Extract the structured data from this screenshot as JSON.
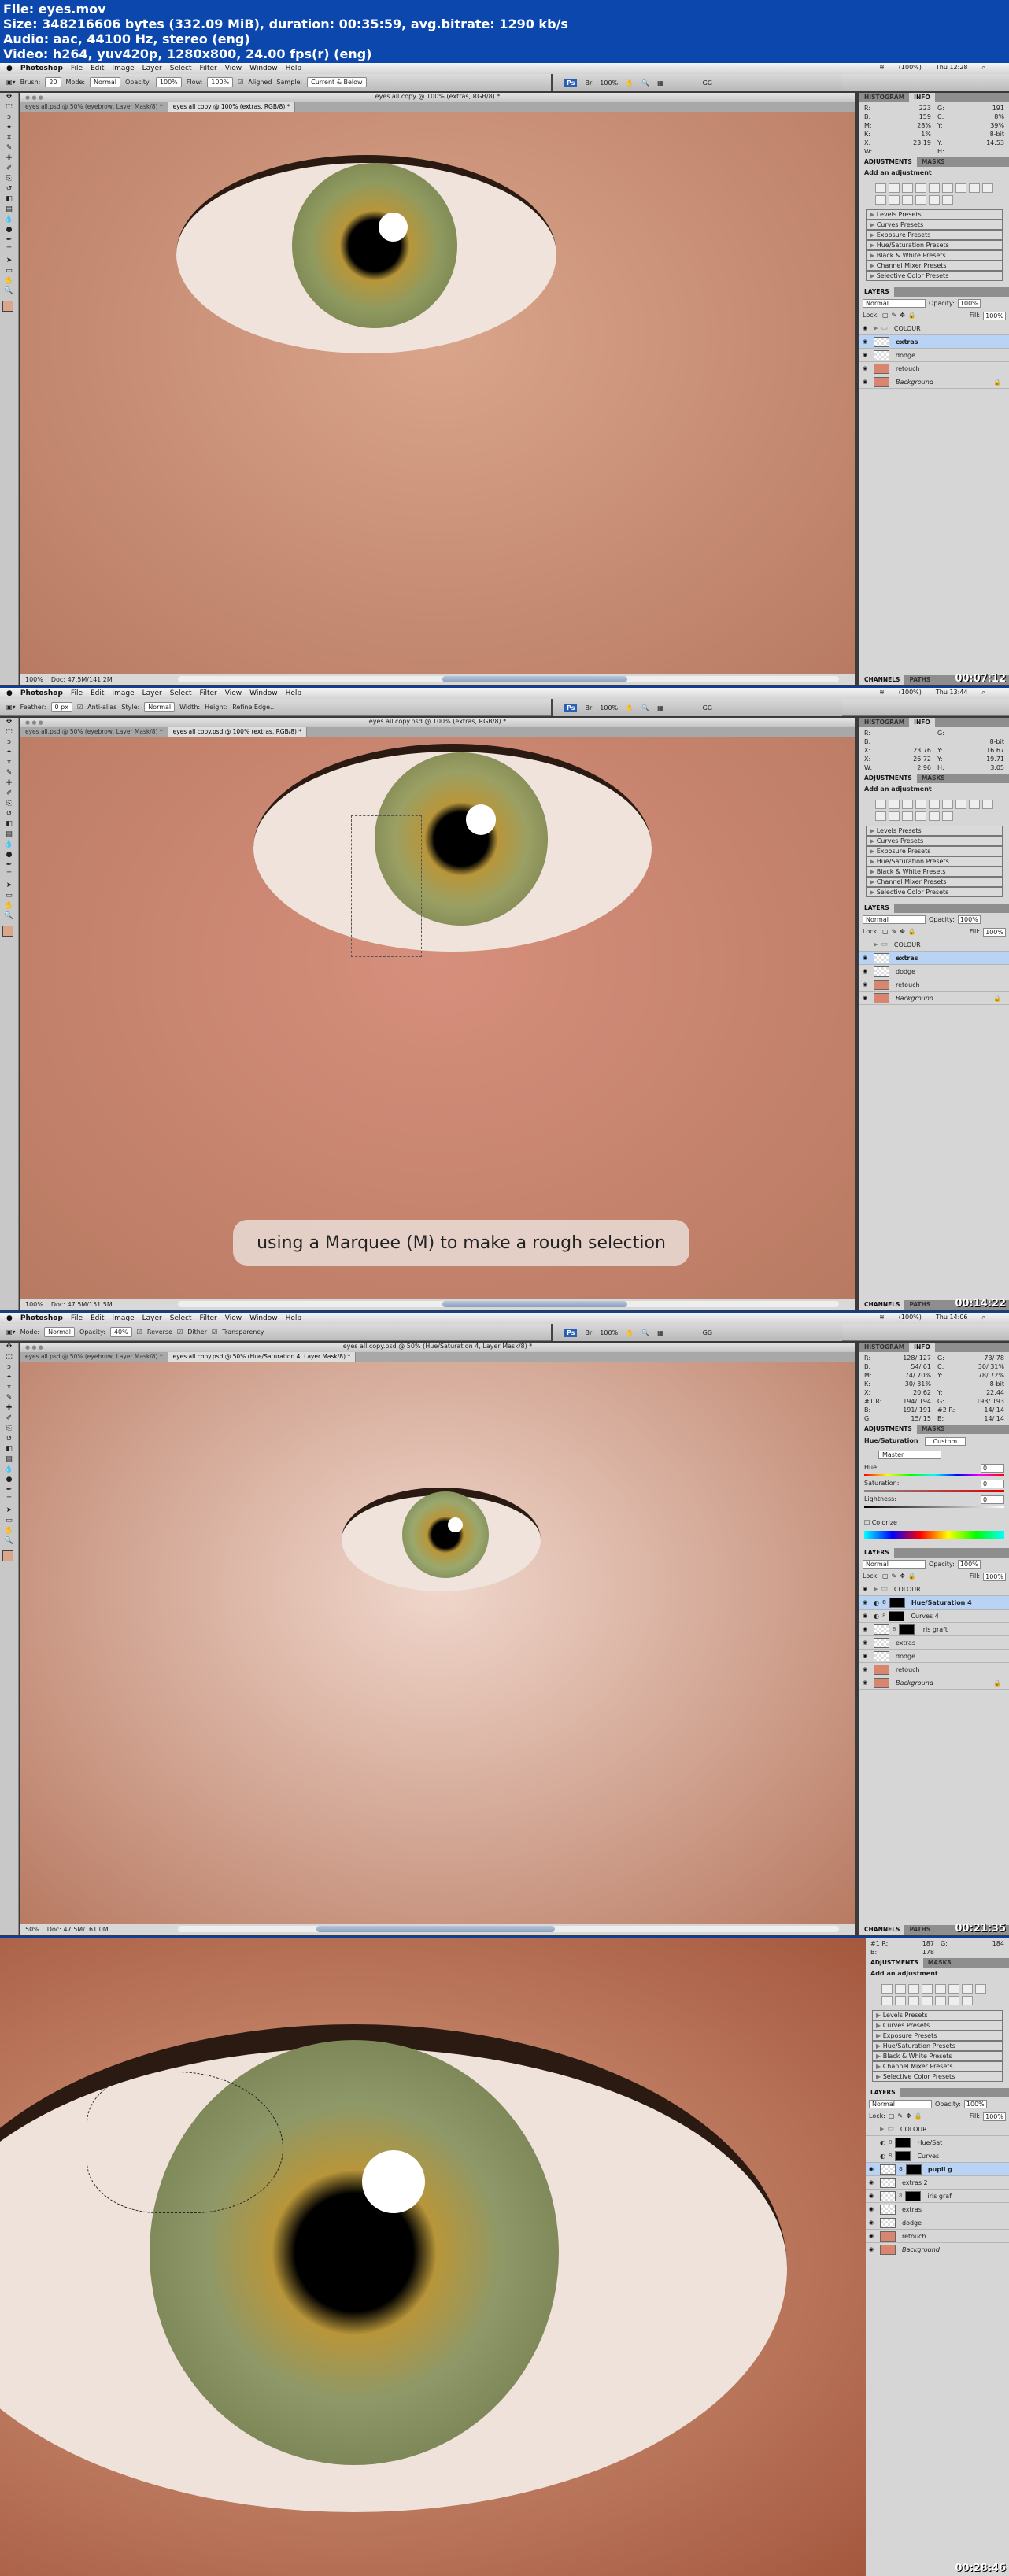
{
  "file_info": {
    "line1": "File: eyes.mov",
    "line2": "Size: 348216606 bytes (332.09 MiB), duration: 00:35:59, avg.bitrate: 1290 kb/s",
    "line3": "Audio: aac, 44100 Hz, stereo (eng)",
    "line4": "Video: h264, yuv420p, 1280x800, 24.00 fps(r) (eng)"
  },
  "menu": {
    "app": "Photoshop",
    "items": [
      "File",
      "Edit",
      "Image",
      "Layer",
      "Select",
      "Filter",
      "View",
      "Window",
      "Help"
    ],
    "battery": "(100%)",
    "workspace": "GG",
    "zoom_btn": "100%"
  },
  "frames": [
    {
      "time": "Thu 12:28",
      "options": {
        "brush_label": "Brush:",
        "brush_size": "20",
        "mode_label": "Mode:",
        "mode": "Normal",
        "opacity_label": "Opacity:",
        "opacity": "100%",
        "flow_label": "Flow:",
        "flow": "100%",
        "aligned": "Aligned",
        "sample_label": "Sample:",
        "sample": "Current & Below"
      },
      "doc_title": "eyes all copy @ 100% (extras, RGB/8) *",
      "tabs": [
        "eyes all.psd @ 50% (eyebrow, Layer Mask/8) *",
        "eyes all copy @ 100% (extras, RGB/8) *"
      ],
      "status_zoom": "100%",
      "status_doc": "Doc: 47.5M/141.2M",
      "info": {
        "R": "223",
        "G": "191",
        "B": "159",
        "C": "8%",
        "M": "28%",
        "Y": "39%",
        "K": "1%",
        "bit": "8-bit",
        "X": "23.19",
        "Yc": "14.53",
        "W": "",
        "H": ""
      },
      "adj_title": "Add an adjustment",
      "layers": [
        {
          "name": "COLOUR",
          "type": "group",
          "visible": true
        },
        {
          "name": "extras",
          "type": "transparent",
          "visible": true,
          "selected": true
        },
        {
          "name": "dodge",
          "type": "transparent",
          "visible": true
        },
        {
          "name": "retouch",
          "type": "skin",
          "visible": true
        },
        {
          "name": "Background",
          "type": "skin",
          "visible": true,
          "locked": true
        }
      ],
      "timecode": "00:07:12"
    },
    {
      "time": "Thu 13:44",
      "options": {
        "feather_label": "Feather:",
        "feather": "0 px",
        "antialias": "Anti-alias",
        "style_label": "Style:",
        "style": "Normal",
        "width_label": "Width:",
        "height_label": "Height:",
        "refine": "Refine Edge..."
      },
      "doc_title": "eyes all copy.psd @ 100% (extras, RGB/8) *",
      "tabs": [
        "eyes all.psd @ 50% (eyebrow, Layer Mask/8) *",
        "eyes all copy.psd @ 100% (extras, RGB/8) *"
      ],
      "status_zoom": "100%",
      "status_doc": "Doc: 47.5M/151.5M",
      "info": {
        "R": "",
        "G": "",
        "B": "",
        "bit": "8-bit",
        "X1": "23.76",
        "Y1": "16.67",
        "X": "26.72",
        "Yc": "19.71",
        "W": "2.96",
        "H": "3.05"
      },
      "adj_title": "Add an adjustment",
      "caption": "using a Marquee (M) to make a rough selection",
      "layers": [
        {
          "name": "COLOUR",
          "type": "group",
          "visible": false
        },
        {
          "name": "extras",
          "type": "transparent",
          "visible": true,
          "selected": true
        },
        {
          "name": "dodge",
          "type": "transparent",
          "visible": true
        },
        {
          "name": "retouch",
          "type": "skin",
          "visible": true
        },
        {
          "name": "Background",
          "type": "skin",
          "visible": true,
          "locked": true
        }
      ],
      "timecode": "00:14:22"
    },
    {
      "time": "Thu 14:06",
      "options": {
        "mode_label": "Mode:",
        "mode": "Normal",
        "opacity_label": "Opacity:",
        "opacity": "40%",
        "reverse": "Reverse",
        "dither": "Dither",
        "transparency": "Transparency"
      },
      "doc_title": "eyes all copy.psd @ 50% (Hue/Saturation 4, Layer Mask/8) *",
      "tabs": [
        "eyes all.psd @ 50% (eyebrow, Layer Mask/8) *",
        "eyes all copy.psd @ 50% (Hue/Saturation 4, Layer Mask/8) *"
      ],
      "status_zoom": "50%",
      "status_doc": "Doc: 47.5M/161.0M",
      "info": {
        "R": "128/ 127",
        "G": "73/ 78",
        "B": "54/ 61",
        "C": "30/ 31%",
        "M": "74/ 70%",
        "Y": "78/ 72%",
        "K": "30/ 31%",
        "bit": "8-bit",
        "X": "20.62",
        "Yc": "22.44",
        "s1R": "194/ 194",
        "s1G": "193/ 193",
        "s1B": "191/ 191",
        "s2R": "14/ 14",
        "s2G": "15/ 15",
        "s2B": "14/ 14"
      },
      "huesat": {
        "title": "Hue/Saturation",
        "preset": "Custom",
        "channel": "Master",
        "hue_label": "Hue:",
        "hue": "0",
        "sat_label": "Saturation:",
        "sat": "0",
        "light_label": "Lightness:",
        "light": "0",
        "colorize": "Colorize"
      },
      "layers": [
        {
          "name": "COLOUR",
          "type": "group",
          "visible": true
        },
        {
          "name": "Hue/Saturation 4",
          "type": "adj",
          "visible": true,
          "selected": true
        },
        {
          "name": "Curves 4",
          "type": "adj",
          "visible": true
        },
        {
          "name": "iris graft",
          "type": "masked",
          "visible": true
        },
        {
          "name": "extras",
          "type": "transparent",
          "visible": true
        },
        {
          "name": "dodge",
          "type": "transparent",
          "visible": true
        },
        {
          "name": "retouch",
          "type": "skin",
          "visible": true
        },
        {
          "name": "Background",
          "type": "skin",
          "visible": true,
          "locked": true
        }
      ],
      "timecode": "00:21:35"
    },
    {
      "info": {
        "s1R": "187",
        "s1G": "184",
        "s1B": "178"
      },
      "adj_title": "Add an adjustment",
      "layers": [
        {
          "name": "COLOUR",
          "type": "group",
          "visible": false
        },
        {
          "name": "Hue/Sat",
          "type": "adj",
          "visible": false
        },
        {
          "name": "Curves",
          "type": "adj",
          "visible": false
        },
        {
          "name": "pupil g",
          "type": "masked",
          "visible": true,
          "selected": true
        },
        {
          "name": "extras 2",
          "type": "transparent",
          "visible": true
        },
        {
          "name": "iris graf",
          "type": "masked",
          "visible": true
        },
        {
          "name": "extras",
          "type": "transparent",
          "visible": true
        },
        {
          "name": "dodge",
          "type": "transparent",
          "visible": true
        },
        {
          "name": "retouch",
          "type": "skin",
          "visible": true
        },
        {
          "name": "Background",
          "type": "skin",
          "visible": true
        }
      ],
      "timecode": "00:28:46"
    }
  ],
  "panel_labels": {
    "histogram": "HISTOGRAM",
    "info": "INFO",
    "adjustments": "ADJUSTMENTS",
    "masks": "MASKS",
    "layers": "LAYERS",
    "channels": "CHANNELS",
    "paths": "PATHS",
    "blend": "Normal",
    "opacity_label": "Opacity:",
    "opacity": "100%",
    "lock_label": "Lock:",
    "fill_label": "Fill:",
    "fill": "100%"
  },
  "presets": [
    "Levels Presets",
    "Curves Presets",
    "Exposure Presets",
    "Hue/Saturation Presets",
    "Black & White Presets",
    "Channel Mixer Presets",
    "Selective Color Presets"
  ]
}
